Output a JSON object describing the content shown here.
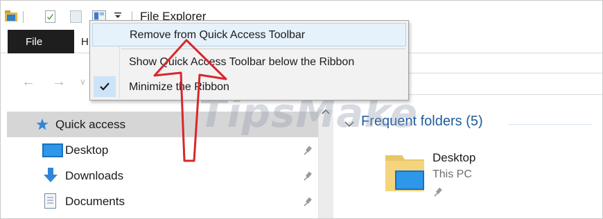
{
  "window": {
    "title": "File Explorer"
  },
  "quick_access_toolbar": {
    "icons": [
      "folder-icon",
      "properties-icon",
      "new-folder-icon",
      "view-icon",
      "customize-dropdown-icon"
    ]
  },
  "ribbon": {
    "tabs": [
      {
        "label": "File",
        "active": true
      },
      {
        "label": "H"
      }
    ]
  },
  "context_menu": {
    "items": [
      {
        "label": "Remove from Quick Access Toolbar",
        "highlighted": true
      },
      {
        "label": "Show Quick Access Toolbar below the Ribbon"
      },
      {
        "label": "Minimize the Ribbon",
        "checked": true
      }
    ]
  },
  "navigation": {
    "back_icon": "arrow-left-icon",
    "forward_icon": "arrow-right-icon",
    "recent_icon": "chevron-down-icon"
  },
  "nav_pane": {
    "items": [
      {
        "label": "Quick access",
        "icon": "star-icon",
        "selected": true
      },
      {
        "label": "Desktop",
        "icon": "desktop-icon",
        "pinned": true
      },
      {
        "label": "Downloads",
        "icon": "download-icon",
        "pinned": true
      },
      {
        "label": "Documents",
        "icon": "document-icon",
        "pinned": true
      }
    ]
  },
  "content": {
    "group_header": "Frequent folders (5)",
    "folders": [
      {
        "name": "Desktop",
        "location": "This PC",
        "pinned": true
      }
    ]
  },
  "watermark": {
    "text": "TipsMake"
  },
  "annotation": {
    "color": "#d9262a"
  }
}
